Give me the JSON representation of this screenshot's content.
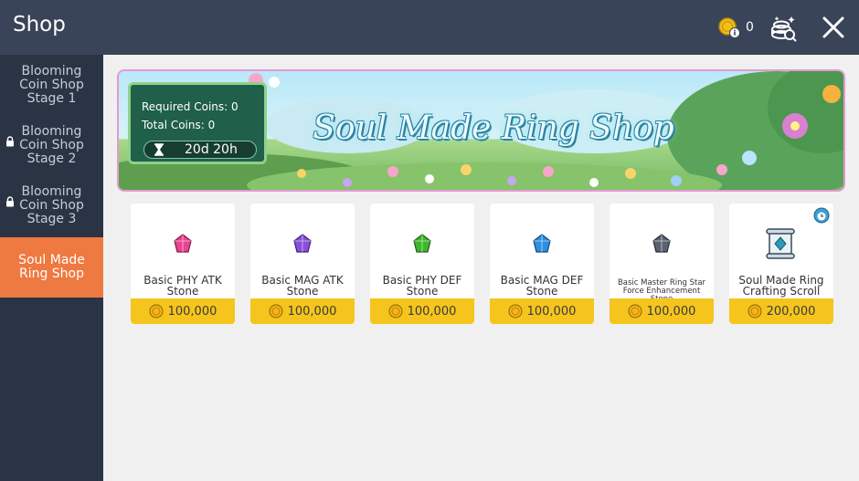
{
  "header": {
    "title": "Shop",
    "coin_count": "0",
    "icons": {
      "coin": "coin-info-icon",
      "storage": "coin-storage-icon",
      "close": "close-icon"
    }
  },
  "sidebar": {
    "tabs": [
      {
        "label": "Blooming Coin Shop Stage 1",
        "locked": false,
        "active": false
      },
      {
        "label": "Blooming Coin Shop Stage 2",
        "locked": true,
        "active": false
      },
      {
        "label": "Blooming Coin Shop Stage 3",
        "locked": true,
        "active": false
      },
      {
        "label": "Soul Made Ring Shop",
        "locked": false,
        "active": true
      }
    ]
  },
  "banner": {
    "title": "Soul Made Ring Shop",
    "required_coins": "Required Coins: 0",
    "total_coins": "Total Coins: 0",
    "timer": "20d 20h"
  },
  "items": [
    {
      "name": "Basic PHY ATK Stone",
      "price": "100,000",
      "gem_color": "#e9448f"
    },
    {
      "name": "Basic MAG ATK Stone",
      "price": "100,000",
      "gem_color": "#8a4fd8"
    },
    {
      "name": "Basic PHY DEF Stone",
      "price": "100,000",
      "gem_color": "#3fb52f"
    },
    {
      "name": "Basic MAG DEF Stone",
      "price": "100,000",
      "gem_color": "#2e8ee0"
    },
    {
      "name": "Basic Master Ring Star Force Enhancement Stone",
      "price": "100,000",
      "gem_color": "#5b6170"
    },
    {
      "name": "Soul Made Ring Crafting Scroll",
      "price": "200,000",
      "gem_color": "#2a9bb5"
    }
  ],
  "colors": {
    "header_bg": "#3a4458",
    "sidebar_bg": "#2b3445",
    "active_tab": "#ee7941",
    "price_button": "#f5c51d",
    "content_bg": "#f0f0f0"
  }
}
